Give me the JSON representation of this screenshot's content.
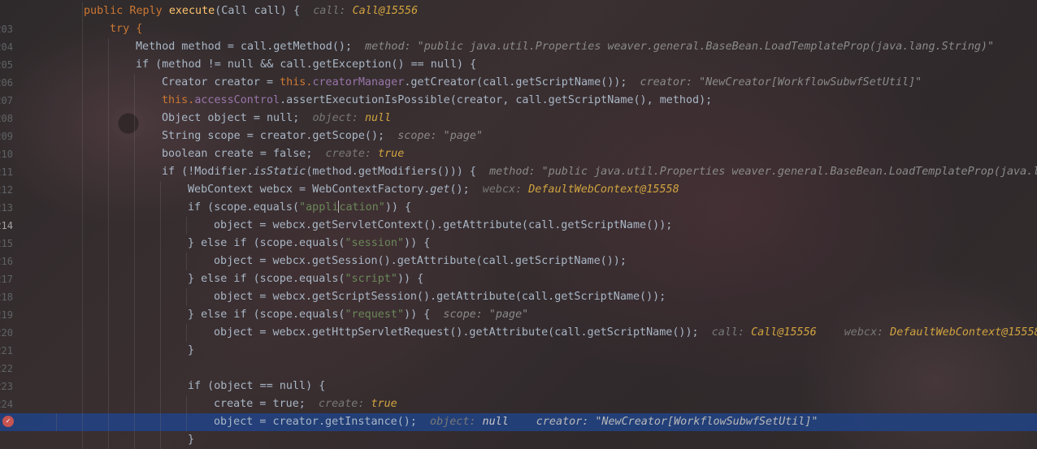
{
  "editor": {
    "lines": [
      {
        "num": "203",
        "parts": [
          "public Reply ",
          "execute",
          "(Call call) {  ",
          "call: ",
          "Call@15556"
        ]
      },
      {
        "num": "204",
        "parts": [
          "try {"
        ]
      },
      {
        "num": "205",
        "parts": [
          "Method method = call.getMethod();  ",
          "method: \"public java.util.Properties weaver.general.BaseBean.LoadTemplateProp(java.lang.String)\""
        ]
      },
      {
        "num": "206",
        "parts": [
          "if (method != null && call.getException() == null) {"
        ]
      },
      {
        "num": "207",
        "parts": [
          "Creator creator = ",
          "this.",
          "creatorManager",
          ".getCreator(call.getScriptName());  ",
          "creator: \"NewCreator[WorkflowSubwfSetUtil]\""
        ]
      },
      {
        "num": "208",
        "parts": [
          "this.",
          "accessControl",
          ".assertExecutionIsPossible(creator, call.getScriptName(), method);"
        ]
      },
      {
        "num": "209",
        "parts": [
          "Object object = null;  ",
          "object: ",
          "null"
        ]
      },
      {
        "num": "210",
        "parts": [
          "String scope = creator.getScope();  ",
          "scope: \"page\""
        ]
      },
      {
        "num": "211",
        "parts": [
          "boolean create = false;  ",
          "create: ",
          "true"
        ]
      },
      {
        "num": "212",
        "parts": [
          "if (!Modifier.",
          "isStatic",
          "(method.getModifiers())) {  ",
          "method: \"public java.util.Properties weaver.general.BaseBean.LoadTemplateProp(java.la"
        ]
      },
      {
        "num": "213",
        "parts": [
          "WebContext webcx = WebContextFactory.",
          "get",
          "();  ",
          "webcx: ",
          "DefaultWebContext@15558"
        ]
      },
      {
        "num": "214",
        "parts": [
          "if (scope.equals(",
          "\"appli",
          "cation\"",
          ")) {"
        ]
      },
      {
        "num": "215",
        "parts": [
          "object = webcx.getServletContext().getAttribute(call.getScriptName());"
        ]
      },
      {
        "num": "216",
        "parts": [
          "} else if (scope.equals(",
          "\"session\"",
          ")) {"
        ]
      },
      {
        "num": "217",
        "parts": [
          "object = webcx.getSession().getAttribute(call.getScriptName());"
        ]
      },
      {
        "num": "218",
        "parts": [
          "} else if (scope.equals(",
          "\"script\"",
          ")) {"
        ]
      },
      {
        "num": "219",
        "parts": [
          "object = webcx.getScriptSession().getAttribute(call.getScriptName());"
        ]
      },
      {
        "num": "220",
        "parts": [
          "} else if (scope.equals(",
          "\"request\"",
          ")) {  ",
          "scope: \"page\""
        ]
      },
      {
        "num": "221",
        "parts": [
          "object = webcx.getHttpServletRequest().getAttribute(call.getScriptName());  ",
          "call: ",
          "Call@15556",
          "webcx: ",
          "DefaultWebContext@15558"
        ]
      },
      {
        "num": "222",
        "parts": [
          "}"
        ]
      },
      {
        "num": "223",
        "parts": [
          ""
        ]
      },
      {
        "num": "224",
        "parts": [
          "if (object == null) {"
        ]
      },
      {
        "num": "225",
        "parts": [
          "create = true;  ",
          "create: ",
          "true"
        ]
      },
      {
        "num": "226",
        "parts": [
          "object = creator.getInstance();  ",
          "object: ",
          "null",
          "creator: \"NewCreator[WorkflowSubwfSetUtil]\""
        ]
      },
      {
        "num": "227",
        "parts": [
          "}"
        ]
      }
    ]
  },
  "colors": {
    "background": "#2b2b2b",
    "keyword": "#cc7832",
    "method_decl": "#ffc66d",
    "string": "#6a8759",
    "field": "#9876aa",
    "inline_value": "#d1a43f",
    "exec_line": "#214283",
    "breakpoint": "#c75450"
  },
  "icons": {
    "breakpoint": "breakpoint-icon"
  }
}
